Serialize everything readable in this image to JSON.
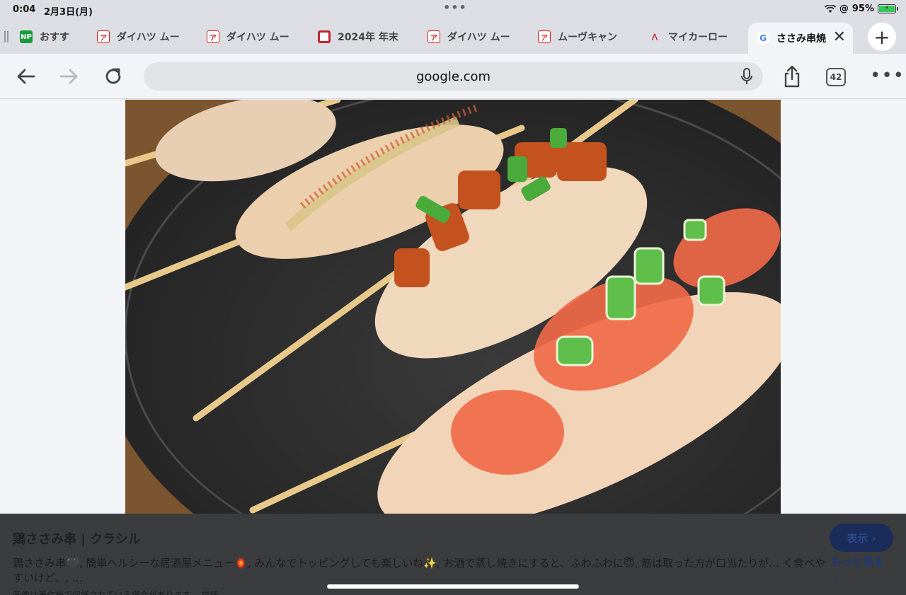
{
  "status": {
    "time": "0:04",
    "date": "2月3日(月)",
    "battery_text": "95%"
  },
  "tabs": [
    {
      "title": "おすす",
      "favicon": "np-logo-icon"
    },
    {
      "title": "ダイハツ ムー",
      "favicon": "daihatsu-icon"
    },
    {
      "title": "ダイハツ ムー",
      "favicon": "daihatsu-icon"
    },
    {
      "title": "2024年 年末",
      "favicon": "ring-logo-icon"
    },
    {
      "title": "ダイハツ ムー",
      "favicon": "daihatsu-icon"
    },
    {
      "title": "ムーヴキャン",
      "favicon": "daihatsu-icon"
    },
    {
      "title": "マイカーロー",
      "favicon": "a-logo-icon"
    }
  ],
  "active_tab": {
    "title": "ささみ串焼",
    "favicon": "google-icon"
  },
  "toolbar": {
    "url": "google.com",
    "tab_count": "42"
  },
  "result": {
    "title": "鶏ささみ串 | クラシル",
    "description": "鶏ささみ串🖤, 簡単ヘルシーな居酒屋メニュー🏮, みんなでトッピングしても楽しいね✨, お酒で蒸し焼きにすると、ふわふわに😇, 筋は取った方が口当たりが… く食べやすいけど、, ...",
    "note": "画像は著作権で保護されている場合があります。 詳細",
    "view_label": "表示 ›",
    "more_label": "もっと見る ⌄"
  },
  "colors": {
    "battery": "#34c759",
    "view_button": "#1a2c5a"
  }
}
